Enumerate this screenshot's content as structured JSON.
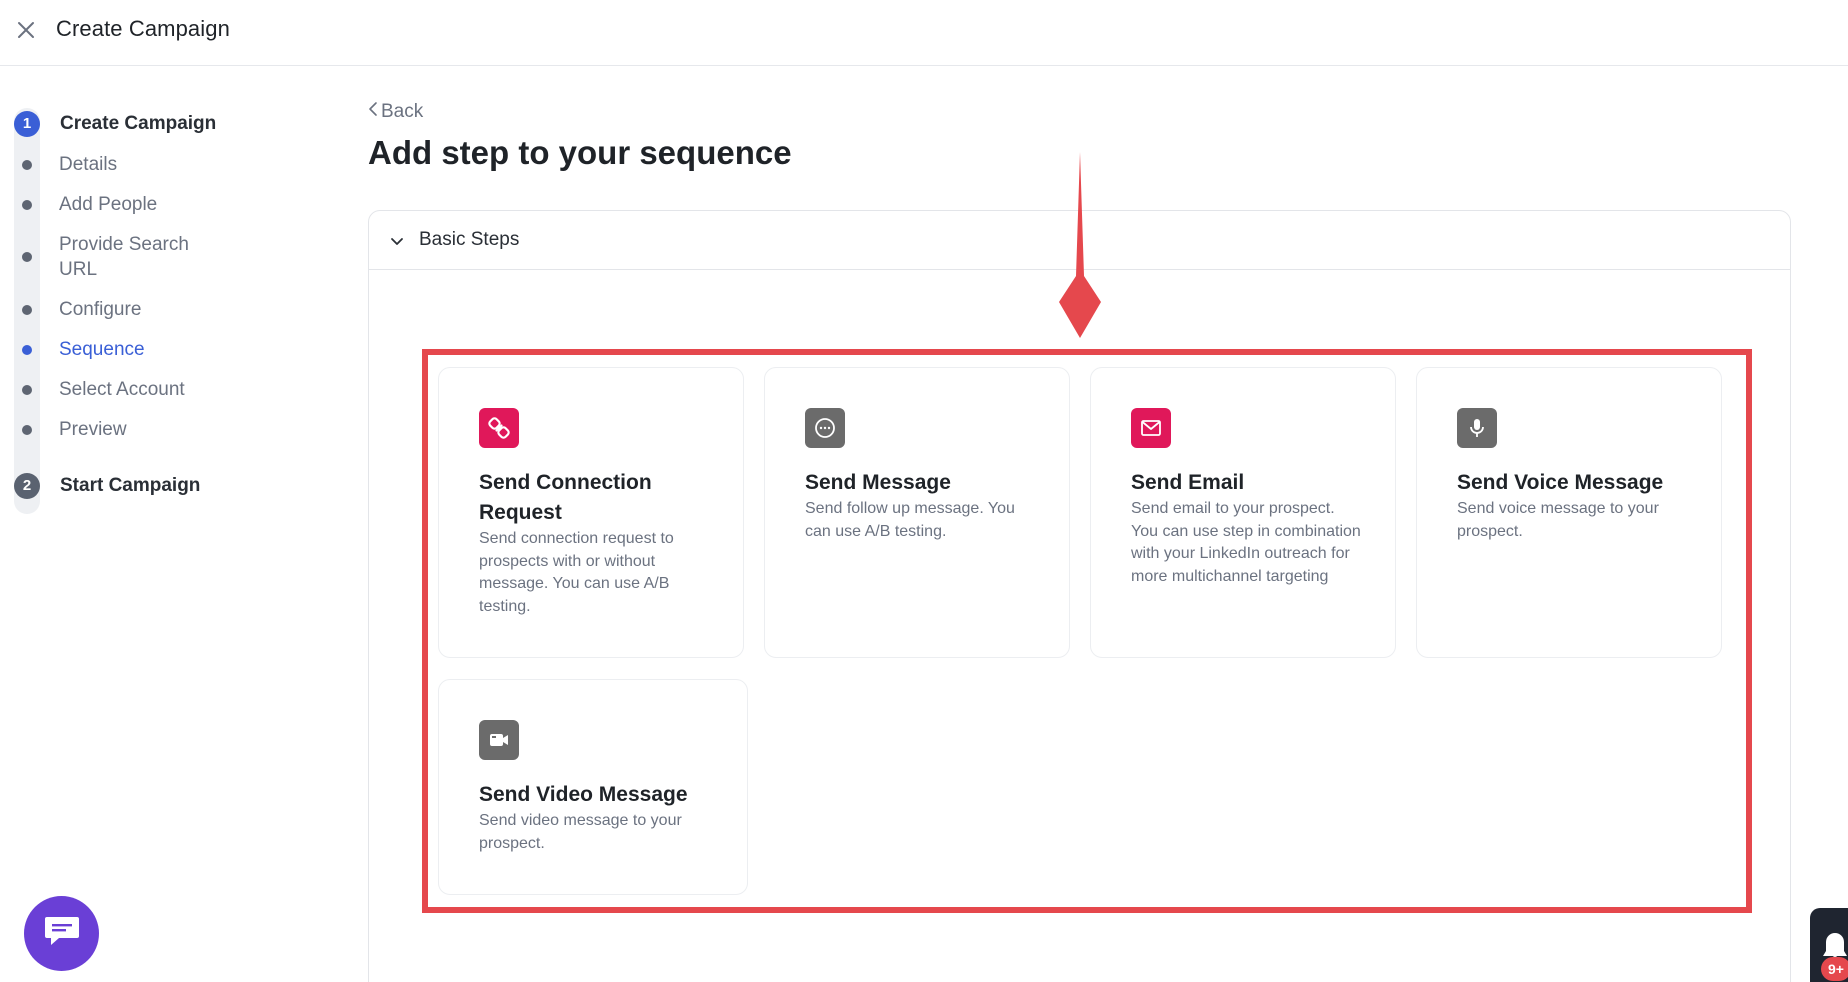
{
  "header": {
    "title": "Create Campaign"
  },
  "stepper": {
    "major": [
      {
        "number": "1",
        "label": "Create Campaign",
        "active": true
      },
      {
        "number": "2",
        "label": "Start Campaign",
        "active": false
      }
    ],
    "minor": [
      {
        "label": "Details",
        "active": false
      },
      {
        "label": "Add People",
        "active": false
      },
      {
        "label": "Provide Search URL",
        "active": false
      },
      {
        "label": "Configure",
        "active": false
      },
      {
        "label": "Sequence",
        "active": true
      },
      {
        "label": "Select Account",
        "active": false
      },
      {
        "label": "Preview",
        "active": false
      }
    ]
  },
  "main": {
    "back_label": "Back",
    "title": "Add step to your sequence",
    "section_label": "Basic Steps",
    "cards": [
      {
        "title": "Send Connection Request",
        "description": "Send connection request to prospects with or without message. You can use A/B testing.",
        "icon": "link-icon",
        "icon_color": "#e0185a"
      },
      {
        "title": "Send Message",
        "description": "Send follow up message. You can use A/B testing.",
        "icon": "chat-bubble-icon",
        "icon_color": "#6b6b6b"
      },
      {
        "title": "Send Email",
        "description": "Send email to your prospect. You can use step in combination with your LinkedIn outreach for more multichannel targeting",
        "icon": "envelope-icon",
        "icon_color": "#e0185a"
      },
      {
        "title": "Send Voice Message",
        "description": "Send voice message to your prospect.",
        "icon": "microphone-icon",
        "icon_color": "#6b6b6b"
      },
      {
        "title": "Send Video Message",
        "description": "Send video message to your prospect.",
        "icon": "video-camera-icon",
        "icon_color": "#6b6b6b"
      }
    ]
  },
  "notifications": {
    "badge": "9+"
  },
  "colors": {
    "accent": "#3a5fd6",
    "highlight": "#e5484d",
    "chat": "#6a3fd6",
    "brand_pink": "#e0185a"
  }
}
